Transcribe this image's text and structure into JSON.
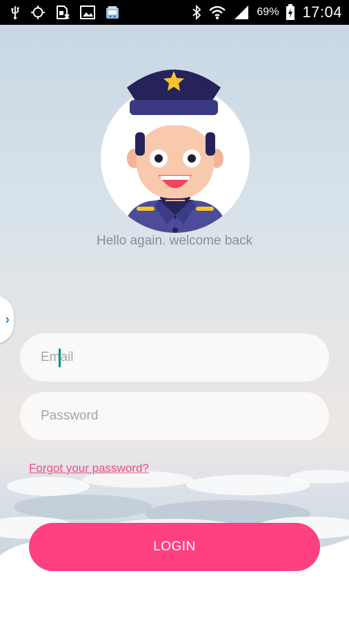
{
  "status_bar": {
    "icons_left": [
      "usb-icon",
      "gps-icon",
      "sim-icon",
      "image-icon",
      "app-icon"
    ],
    "icons_right": [
      "bluetooth-icon",
      "wifi-icon",
      "signal-icon",
      "battery-icon"
    ],
    "battery": "69%",
    "time": "17:04"
  },
  "welcome_text": "Hello again. welcome back",
  "form": {
    "email_placeholder": "Email",
    "password_placeholder": "Password",
    "forgot_label": "Forgot your password?",
    "login_label": "LOGIN"
  },
  "colors": {
    "accent": "#ff4081",
    "link": "#ef4f7f",
    "caret": "#138a8a",
    "hat": "#26235a",
    "uniform": "#4c4c9a"
  }
}
